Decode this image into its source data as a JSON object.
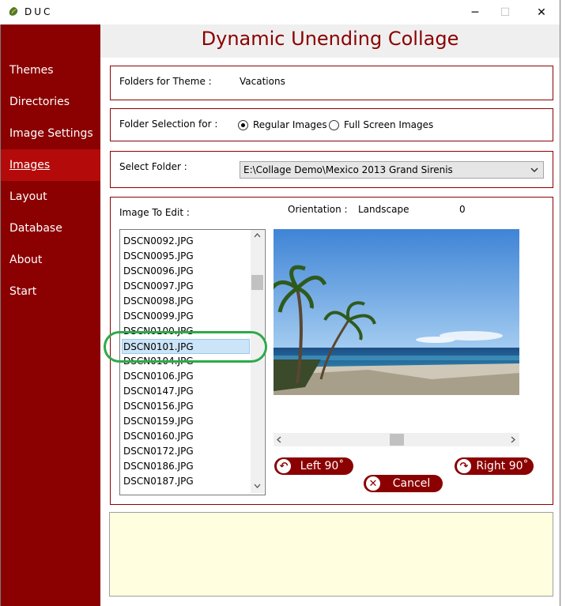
{
  "window": {
    "title": "DUC",
    "minimize": "─",
    "maximize": "☐",
    "close": "✕"
  },
  "header": {
    "title": "Dynamic Unending Collage"
  },
  "sidebar": {
    "items": [
      {
        "label": "Themes"
      },
      {
        "label": "Directories"
      },
      {
        "label": "Image Settings"
      },
      {
        "label": "Images",
        "active": true
      },
      {
        "label": "Layout"
      },
      {
        "label": "Database"
      },
      {
        "label": "About"
      },
      {
        "label": "Start"
      }
    ]
  },
  "theme_panel": {
    "label": "Folders for Theme :",
    "value": "Vacations"
  },
  "selection_panel": {
    "label": "Folder Selection for :",
    "options": [
      {
        "label": "Regular Images",
        "checked": true
      },
      {
        "label": "Full Screen Images",
        "checked": false
      }
    ]
  },
  "folder_panel": {
    "label": "Select Folder :",
    "value": "E:\\Collage Demo\\Mexico 2013 Grand Sirenis"
  },
  "image_panel": {
    "label": "Image To Edit :",
    "orientation_label": "Orientation :",
    "orientation_value": "Landscape",
    "rotation_value": "0",
    "files": [
      "DSCN0092.JPG",
      "DSCN0095.JPG",
      "DSCN0096.JPG",
      "DSCN0097.JPG",
      "DSCN0098.JPG",
      "DSCN0099.JPG",
      "DSCN0100.JPG",
      "DSCN0101.JPG",
      "DSCN0104.JPG",
      "DSCN0106.JPG",
      "DSCN0147.JPG",
      "DSCN0156.JPG",
      "DSCN0159.JPG",
      "DSCN0160.JPG",
      "DSCN0172.JPG",
      "DSCN0186.JPG",
      "DSCN0187.JPG"
    ],
    "selected_file": "DSCN0101.JPG",
    "list_scroll_position": 0.15,
    "preview_scroll_position": 0.5
  },
  "buttons": {
    "left": "Left 90˚",
    "right": "Right 90˚",
    "cancel": "Cancel"
  },
  "colors": {
    "primary": "#8b0000",
    "active_nav": "#b50a0a",
    "highlight_ring": "#2eaa4a",
    "message_bg": "#ffffe0"
  }
}
